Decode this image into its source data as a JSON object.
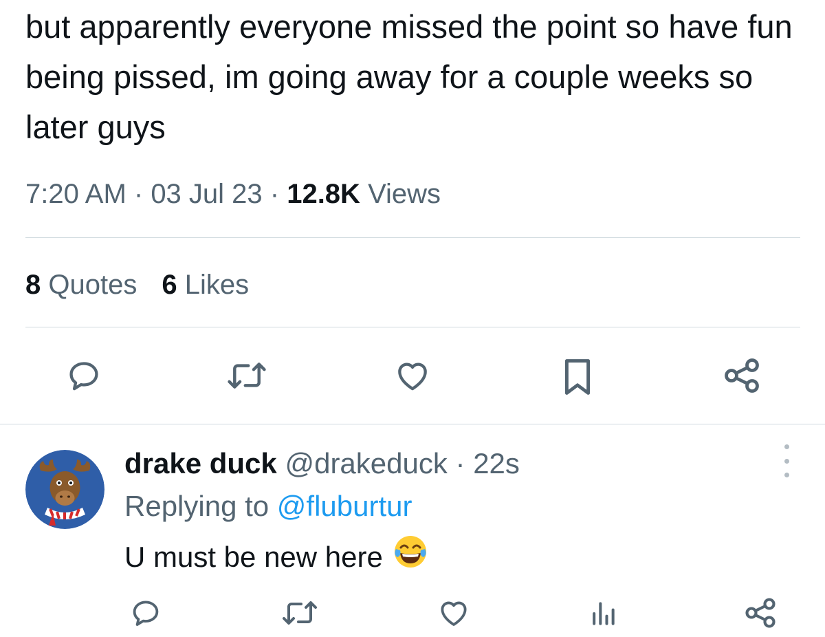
{
  "tweet": {
    "text": "but apparently everyone missed the point so have fun being pissed, im going away for a couple weeks so later guys",
    "time": "7:20 AM",
    "separator1": " · ",
    "date": "03 Jul 23",
    "separator2": " · ",
    "views_count": "12.8K",
    "views_label": " Views",
    "stats": {
      "quotes_count": "8",
      "quotes_label": " Quotes",
      "likes_count": "6",
      "likes_label": " Likes"
    },
    "actions": [
      "reply-icon",
      "retweet-icon",
      "like-icon",
      "bookmark-icon",
      "share-icon"
    ]
  },
  "reply": {
    "display_name": "drake duck",
    "handle": " @drakeduck",
    "separator": " · ",
    "age": "22s",
    "replying_label": "Replying to ",
    "replying_to": "@fluburtur",
    "text": "U must be new here",
    "emoji": "face-with-tears-of-joy",
    "actions": [
      "reply-icon",
      "retweet-icon",
      "like-icon",
      "views-icon",
      "share-icon"
    ]
  },
  "colors": {
    "text_primary": "#0f1419",
    "text_secondary": "#536471",
    "link": "#1d9bf0",
    "divider": "#cfd9de",
    "icon": "#536471"
  }
}
